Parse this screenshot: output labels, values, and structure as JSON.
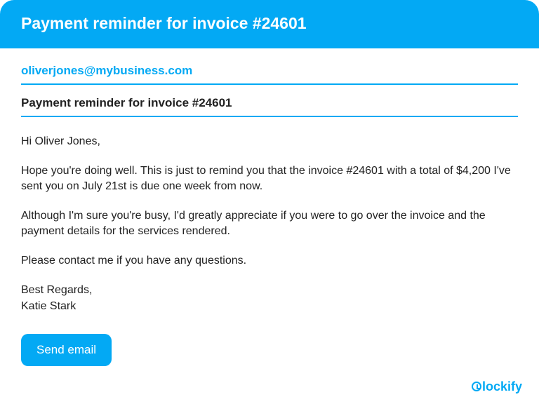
{
  "header": {
    "title": "Payment reminder for invoice #24601"
  },
  "email": {
    "recipient": "oliverjones@mybusiness.com",
    "subject": "Payment reminder for invoice #24601",
    "greeting": "Hi Oliver Jones,",
    "paragraph1": "Hope you're doing well. This is just to remind you that the invoice #24601 with a total of $4,200 I've sent you on July 21st is due one week from now.",
    "paragraph2": "Although I'm sure you're busy, I'd greatly appreciate if you were to go over the invoice and the payment details for the services rendered.",
    "paragraph3": "Please contact me if you have any questions.",
    "signoff_line1": "Best Regards,",
    "signoff_line2": "Katie Stark"
  },
  "actions": {
    "send_label": "Send email"
  },
  "brand": {
    "name": "lockify"
  }
}
